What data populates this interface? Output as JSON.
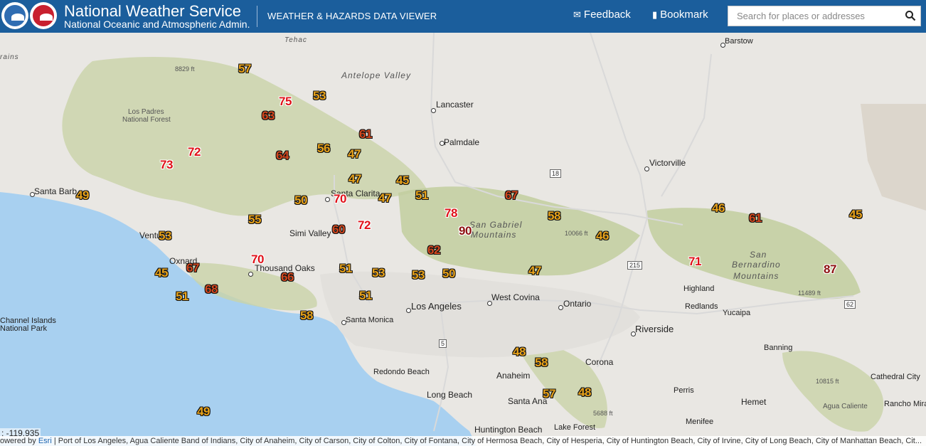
{
  "header": {
    "title": "National Weather Service",
    "subtitle": "National Oceanic and Atmospheric Admin.",
    "viewer": "WEATHER & HAZARDS DATA VIEWER",
    "feedback_label": "Feedback",
    "bookmark_label": "Bookmark",
    "search_placeholder": "Search for places or addresses",
    "brand_color": "#1b5e9c"
  },
  "map": {
    "places": [
      "Barstow",
      "Lancaster",
      "Palmdale",
      "Victorville",
      "Santa Barb",
      "Santa Clarita",
      "Simi Valley",
      "Ventu",
      "Oxnard",
      "Thousand Oaks",
      "Los Angeles",
      "West Covina",
      "Ontario",
      "Riverside",
      "Highland",
      "Redlands",
      "Yucaipa",
      "Santa Monica",
      "Banning",
      "Corona",
      "Anaheim",
      "Redondo Beach",
      "Long Beach",
      "Santa Ana",
      "Perris",
      "Hemet",
      "Huntington Beach",
      "Lake Forest",
      "Menifee",
      "Cathedral City",
      "Rancho Mirag",
      "Agua Caliente",
      "Channel Islands",
      "National Park"
    ],
    "regions": [
      "Antelope Valley",
      "San Gabriel",
      "Mountains",
      "San",
      "Bernardino",
      "Mountains",
      "Los Padres",
      "National Forest",
      "Tehac",
      "rains"
    ],
    "elevations": [
      "8829 ft",
      "10066 ft",
      "11489 ft",
      "10815 ft",
      "5688 ft"
    ],
    "shields": [
      "18",
      "215",
      "5",
      "62"
    ],
    "temperatures": [
      57,
      75,
      53,
      63,
      61,
      72,
      64,
      56,
      47,
      73,
      47,
      45,
      49,
      50,
      70,
      47,
      51,
      67,
      78,
      55,
      60,
      72,
      90,
      58,
      46,
      46,
      61,
      45,
      53,
      62,
      71,
      87,
      70,
      45,
      67,
      51,
      53,
      53,
      50,
      47,
      66,
      51,
      68,
      51,
      58,
      48,
      58,
      57,
      48,
      49
    ],
    "coord_readout": ": -119.935",
    "attribution_prefix": "owered by ",
    "attribution_esri": "Esri",
    "attribution_rest": " | Port of Los Angeles, Agua Caliente Band of Indians, City of Anaheim, City of Carson, City of Colton, City of Fontana, City of Hermosa Beach, City of Hesperia, City of Huntington Beach, City of Irvine, City of Long Beach, City of Manhattan Beach, Cit...",
    "colors": {
      "ocean": "#a8d0f0",
      "land": "#e9e7e3",
      "mountains": "#c9d3a8",
      "temp_orange": "#e8a21a",
      "temp_redorange": "#d3471e",
      "temp_red": "#e0111a",
      "temp_darkred": "#8d1010"
    }
  }
}
